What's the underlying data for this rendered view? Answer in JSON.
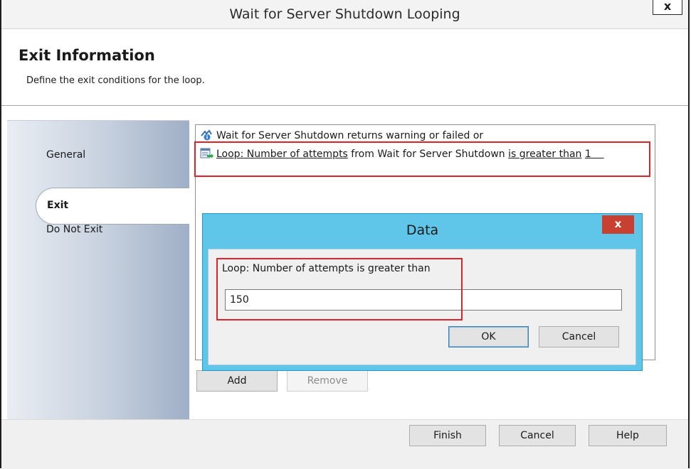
{
  "window": {
    "title": "Wait for Server Shutdown Looping",
    "close_glyph": "x"
  },
  "header": {
    "title": "Exit Information",
    "subtitle": "Define the exit conditions for the loop."
  },
  "nav": {
    "items": [
      {
        "label": "General",
        "selected": false
      },
      {
        "label": "Exit",
        "selected": true
      },
      {
        "label": "Do Not Exit",
        "selected": false
      }
    ]
  },
  "conditions": {
    "row1": {
      "icon": "status-warning-info-icon",
      "text": "Wait for Server Shutdown returns warning or failed or"
    },
    "row2": {
      "icon": "loop-condition-icon",
      "part1": "Loop: Number of attempts",
      "part2": " from Wait for Server Shutdown ",
      "part3": "is greater than",
      "part4": " ",
      "part5": "1"
    },
    "add_label": "Add",
    "remove_label": "Remove"
  },
  "dialog": {
    "title": "Data",
    "close_glyph": "x",
    "label": "Loop: Number of attempts is greater than",
    "value": "150",
    "ok_label": "OK",
    "cancel_label": "Cancel",
    "accent": "#5fc6ea",
    "close_color": "#c84032"
  },
  "footer": {
    "finish_label": "Finish",
    "cancel_label": "Cancel",
    "help_label": "Help"
  },
  "colors": {
    "highlight": "#e2222a"
  }
}
